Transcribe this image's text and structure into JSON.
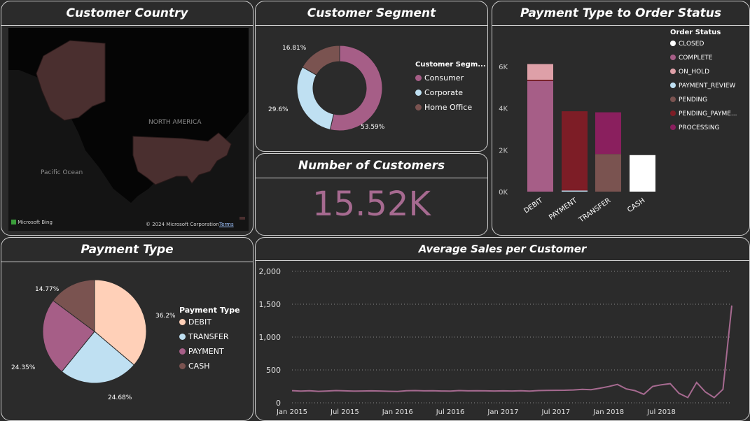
{
  "panels": {
    "country_title": "Customer Country",
    "segment_title": "Customer Segment",
    "customers_title": "Number of Customers",
    "paystatus_title": "Payment Type to Order Status",
    "paytype_title": "Payment Type",
    "avgsales_title": "Average Sales per Customer"
  },
  "map": {
    "north_america_label": "NORTH AMERICA",
    "pacific_label": "Pacific Ocean",
    "bing_label": "Microsoft Bing",
    "copyright": "© 2024 Microsoft Corporation",
    "terms": "Terms"
  },
  "kpi": {
    "value": "15.52K"
  },
  "colors": {
    "consumer": "#a65e87",
    "corporate": "#bfe0f2",
    "home_office": "#7a5350",
    "debit": "#ffd0b8",
    "cash": "#7a5350",
    "closed": "#ffffff",
    "complete": "#a65e87",
    "on_hold": "#dea0a8",
    "payment_review": "#bfe0f2",
    "pending": "#7a5350",
    "pending_payment": "#7d1d26",
    "processing": "#8a1f5e",
    "line": "#a66a90"
  },
  "chart_data": [
    {
      "type": "pie",
      "variant": "donut",
      "legend_title": "Customer Segm...",
      "labels": [
        "Consumer",
        "Corporate",
        "Home Office"
      ],
      "values": [
        53.59,
        29.6,
        16.81
      ],
      "data_labels": [
        "53.59%",
        "29.6%",
        "16.81%"
      ],
      "legend": "right"
    },
    {
      "type": "pie",
      "legend_title": "Payment Type",
      "labels": [
        "DEBIT",
        "TRANSFER",
        "PAYMENT",
        "CASH"
      ],
      "values": [
        36.2,
        24.68,
        24.35,
        14.77
      ],
      "data_labels": [
        "36.2%",
        "24.68%",
        "24.35%",
        "14.77%"
      ],
      "legend": "right"
    },
    {
      "type": "bar",
      "stacked": true,
      "legend_title": "Order Status",
      "categories": [
        "DEBIT",
        "PAYMENT",
        "TRANSFER",
        "CASH"
      ],
      "series": [
        {
          "name": "CLOSED",
          "values": [
            0,
            0,
            0,
            1750
          ]
        },
        {
          "name": "COMPLETE",
          "values": [
            5300,
            0,
            0,
            0
          ]
        },
        {
          "name": "ON_HOLD",
          "values": [
            750,
            0,
            0,
            0
          ]
        },
        {
          "name": "PAYMENT_REVIEW",
          "values": [
            0,
            50,
            0,
            0
          ]
        },
        {
          "name": "PENDING",
          "values": [
            0,
            0,
            1800,
            0
          ]
        },
        {
          "name": "PENDING_PAYME...",
          "values": [
            60,
            3800,
            0,
            0
          ]
        },
        {
          "name": "PROCESSING",
          "values": [
            0,
            0,
            2000,
            0
          ]
        }
      ],
      "yticks": [
        "0K",
        "2K",
        "4K",
        "6K"
      ],
      "ylim": [
        0,
        6500
      ],
      "legend": "right"
    },
    {
      "type": "line",
      "x": [
        "2015-01",
        "2015-02",
        "2015-03",
        "2015-04",
        "2015-05",
        "2015-06",
        "2015-07",
        "2015-08",
        "2015-09",
        "2015-10",
        "2015-11",
        "2015-12",
        "2016-01",
        "2016-02",
        "2016-03",
        "2016-04",
        "2016-05",
        "2016-06",
        "2016-07",
        "2016-08",
        "2016-09",
        "2016-10",
        "2016-11",
        "2016-12",
        "2017-01",
        "2017-02",
        "2017-03",
        "2017-04",
        "2017-05",
        "2017-06",
        "2017-07",
        "2017-08",
        "2017-09",
        "2017-10",
        "2017-11",
        "2017-12",
        "2018-01",
        "2018-02",
        "2018-03",
        "2018-04",
        "2018-05",
        "2018-06",
        "2018-07",
        "2018-08",
        "2018-09",
        "2018-10",
        "2018-11",
        "2018-12",
        "2019-01"
      ],
      "values": [
        185,
        178,
        184,
        175,
        180,
        186,
        182,
        178,
        180,
        182,
        180,
        176,
        172,
        184,
        186,
        182,
        184,
        180,
        178,
        186,
        182,
        184,
        182,
        180,
        182,
        180,
        184,
        178,
        186,
        188,
        190,
        192,
        196,
        205,
        200,
        222,
        248,
        280,
        212,
        185,
        130,
        250,
        275,
        292,
        145,
        80,
        310,
        165,
        80,
        205,
        1480
      ],
      "xticks": [
        "Jan 2015",
        "Jul 2015",
        "Jan 2016",
        "Jul 2016",
        "Jan 2017",
        "Jul 2017",
        "Jan 2018",
        "Jul 2018"
      ],
      "yticks": [
        "0",
        "500",
        "1,000",
        "1,500",
        "2,000"
      ],
      "ylim": [
        0,
        2000
      ],
      "grid": true
    }
  ]
}
